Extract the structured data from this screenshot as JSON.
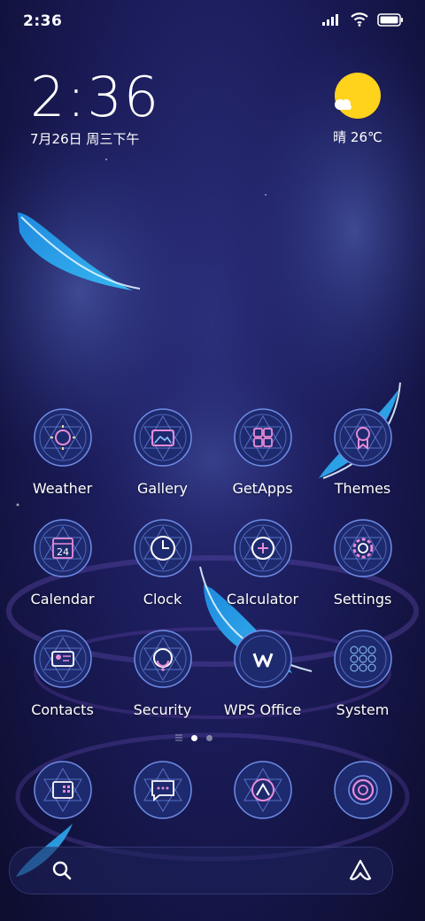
{
  "status_bar": {
    "time": "2:36",
    "icons": [
      "signal-icon",
      "wifi-icon",
      "battery-icon"
    ]
  },
  "clock_widget": {
    "time": "2:36",
    "date": "7月26日 周三下午"
  },
  "weather_widget": {
    "icon": "sunny-cloud-icon",
    "text": "晴 26℃"
  },
  "apps": [
    {
      "label": "Weather",
      "icon": "weather-icon"
    },
    {
      "label": "Gallery",
      "icon": "gallery-icon"
    },
    {
      "label": "GetApps",
      "icon": "getapps-icon"
    },
    {
      "label": "Themes",
      "icon": "themes-icon"
    },
    {
      "label": "Calendar",
      "icon": "calendar-icon",
      "number": "24"
    },
    {
      "label": "Clock",
      "icon": "clock-icon"
    },
    {
      "label": "Calculator",
      "icon": "calculator-icon"
    },
    {
      "label": "Settings",
      "icon": "settings-icon"
    },
    {
      "label": "Contacts",
      "icon": "contacts-icon"
    },
    {
      "label": "Security",
      "icon": "security-icon"
    },
    {
      "label": "WPS Office",
      "icon": "wps-office-icon"
    },
    {
      "label": "System",
      "icon": "system-folder-icon"
    }
  ],
  "page_indicator": {
    "pages": 2,
    "active": 1
  },
  "dock": [
    {
      "icon": "phone-icon"
    },
    {
      "icon": "messages-icon"
    },
    {
      "icon": "browser-icon"
    },
    {
      "icon": "camera-icon"
    }
  ],
  "search_bar": {
    "left_icon": "search-icon",
    "right_icon": "assistant-icon"
  },
  "colors": {
    "icon_ring": "#6f8ee8",
    "icon_glyph": "#e98bd8",
    "icon_fill": "#1e2a6e",
    "sun": "#ffd21c",
    "feather": "#2fa7ee"
  }
}
